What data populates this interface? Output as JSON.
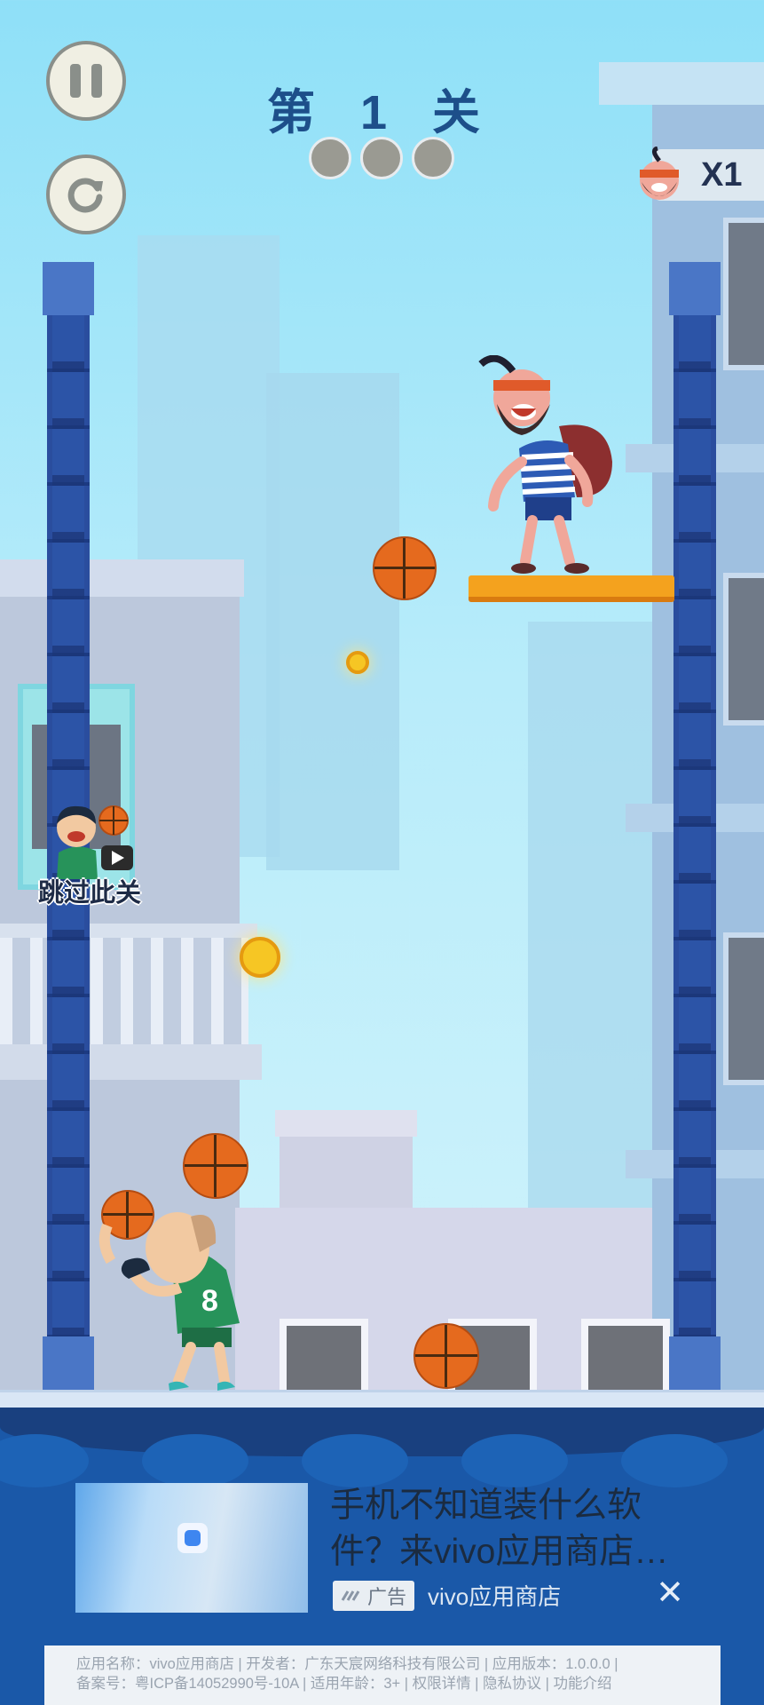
{
  "hud": {
    "level_title": "第 1 关",
    "stars_total": 3,
    "lives_label": "X1"
  },
  "skip_level": {
    "label": "跳过此关"
  },
  "ad": {
    "title": "手机不知道装什么软件？来vivo应用商店…",
    "tag_label": "广告",
    "source": "vivo应用商店",
    "info_line1": "应用名称：vivo应用商店 | 开发者：广东天宸网络科技有限公司 | 应用版本：1.0.0.0 |",
    "info_line2": "备案号：粤ICP备14052990号-10A | 适用年龄：3+ | 权限详情 | 隐私协议 | 功能介绍"
  },
  "colors": {
    "title": "#1d4f8a",
    "post": "#21418e",
    "platform": "#f4a21e",
    "ball": "#e56a1e",
    "water": "#1a58a8"
  }
}
